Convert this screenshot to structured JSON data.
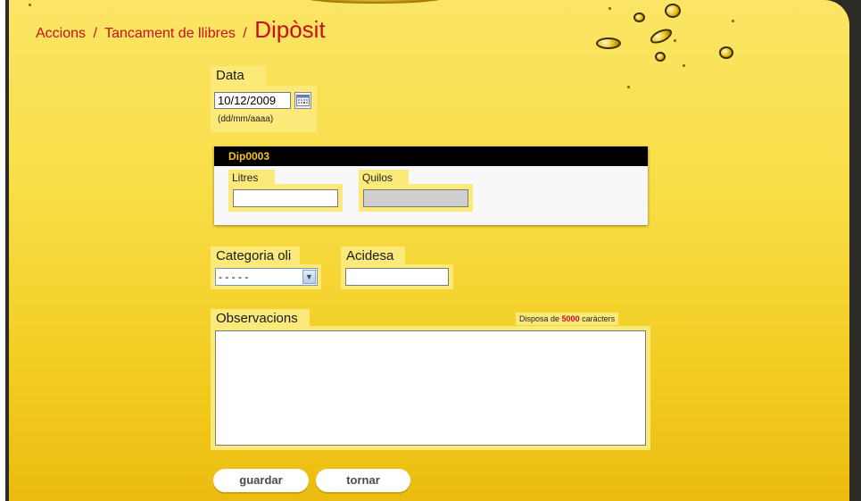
{
  "breadcrumb": {
    "item1": "Accions",
    "separator": "/",
    "item2": "Tancament de llibres",
    "current": "Dipòsit"
  },
  "date": {
    "label": "Data",
    "value": "10/12/2009",
    "format_hint": "(dd/mm/aaaa)"
  },
  "deposit": {
    "code": "Dip0003",
    "litres_label": "Litres",
    "litres_value": "",
    "quilos_label": "Quilos",
    "quilos_value": ""
  },
  "category": {
    "label": "Categoria oli",
    "selected": "- - - - -"
  },
  "acidity": {
    "label": "Acidesa",
    "value": ""
  },
  "observations": {
    "label": "Observacions",
    "counter_prefix": "Disposa de",
    "counter_value": "5000",
    "counter_suffix": "caràcters",
    "value": ""
  },
  "buttons": {
    "save": "guardar",
    "back": "tornar"
  },
  "colors": {
    "accent_red": "#c8101a",
    "field_bg": "#fbe97a",
    "header_black": "#000000",
    "header_text": "#f5c518"
  },
  "icons": {
    "calendar": "calendar-icon",
    "dropdown": "chevron-down-icon"
  }
}
